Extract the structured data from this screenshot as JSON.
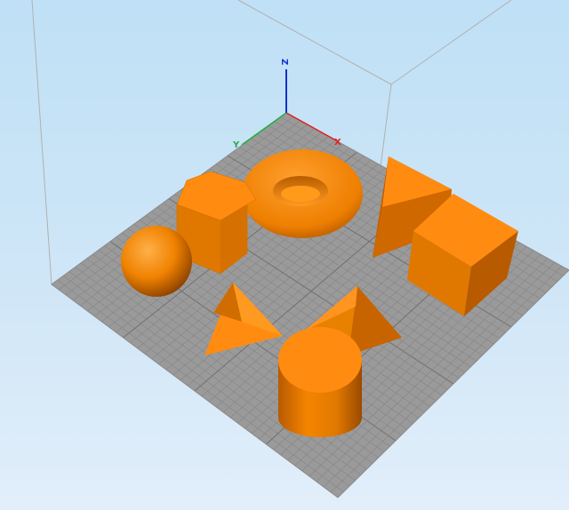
{
  "viewport": {
    "axes": {
      "x": {
        "label": "X",
        "color": "#e02020"
      },
      "y": {
        "label": "Y",
        "color": "#20b040"
      },
      "z": {
        "label": "Z",
        "color": "#1030d0"
      }
    },
    "colors": {
      "background_top": "#bfe0f6",
      "background_bottom": "#e2eefa",
      "build_plate": "#9a9a9a",
      "grid_line": "#858585",
      "object": "#ff8c00",
      "build_volume_edge": "#b0b0b0"
    },
    "objects": [
      {
        "name": "torus",
        "color": "#ff8c00"
      },
      {
        "name": "hexagonal-prism",
        "color": "#ff8c00"
      },
      {
        "name": "sphere",
        "color": "#ff8c00"
      },
      {
        "name": "wedge",
        "color": "#ff8c00"
      },
      {
        "name": "cube",
        "color": "#ff8c00"
      },
      {
        "name": "tetrahedron",
        "color": "#ff8c00"
      },
      {
        "name": "square-pyramid",
        "color": "#ff8c00"
      },
      {
        "name": "cylinder",
        "color": "#ff8c00"
      }
    ]
  }
}
